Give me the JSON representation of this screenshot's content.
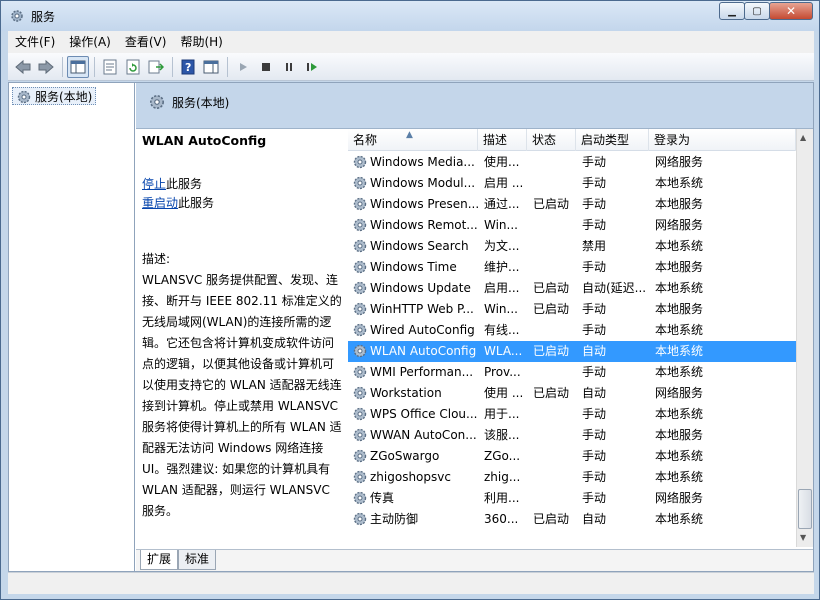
{
  "window": {
    "title": "服务"
  },
  "menu": [
    "文件(F)",
    "操作(A)",
    "查看(V)",
    "帮助(H)"
  ],
  "tree": {
    "root_label": "服务(本地)"
  },
  "pane": {
    "header_title": "服务(本地)"
  },
  "detail": {
    "service_name": "WLAN AutoConfig",
    "stop_link": "停止",
    "stop_suffix": "此服务",
    "restart_link": "重启动",
    "restart_suffix": "此服务",
    "desc_label": "描述:",
    "desc_lines": [
      "WLANSVC 服务提供配置、发现、连",
      "接、断开与 IEEE 802.11 标准定义的",
      "无线局域网(WLAN)的连接所需的逻",
      "辑。它还包含将计算机变成软件访问",
      "点的逻辑，以便其他设备或计算机可",
      "以使用支持它的 WLAN 适配器无线连",
      "接到计算机。停止或禁用 WLANSVC",
      "服务将使得计算机上的所有 WLAN 适",
      "配器无法访问 Windows 网络连接",
      "UI。强烈建议: 如果您的计算机具有",
      "WLAN 适配器，则运行 WLANSVC",
      "服务。"
    ]
  },
  "columns": {
    "name": "名称",
    "desc": "描述",
    "status": "状态",
    "startup": "启动类型",
    "logon": "登录为"
  },
  "rows": [
    {
      "name": "Windows Media...",
      "desc": "使用...",
      "status": "",
      "startup": "手动",
      "logon": "网络服务"
    },
    {
      "name": "Windows Modul...",
      "desc": "启用 ...",
      "status": "",
      "startup": "手动",
      "logon": "本地系统"
    },
    {
      "name": "Windows Presen...",
      "desc": "通过...",
      "status": "已启动",
      "startup": "手动",
      "logon": "本地服务"
    },
    {
      "name": "Windows Remot...",
      "desc": "Win...",
      "status": "",
      "startup": "手动",
      "logon": "网络服务"
    },
    {
      "name": "Windows Search",
      "desc": "为文...",
      "status": "",
      "startup": "禁用",
      "logon": "本地系统"
    },
    {
      "name": "Windows Time",
      "desc": "维护...",
      "status": "",
      "startup": "手动",
      "logon": "本地服务"
    },
    {
      "name": "Windows Update",
      "desc": "启用...",
      "status": "已启动",
      "startup": "自动(延迟...",
      "logon": "本地系统"
    },
    {
      "name": "WinHTTP Web P...",
      "desc": "Win...",
      "status": "已启动",
      "startup": "手动",
      "logon": "本地服务"
    },
    {
      "name": "Wired AutoConfig",
      "desc": "有线...",
      "status": "",
      "startup": "手动",
      "logon": "本地系统"
    },
    {
      "name": "WLAN AutoConfig",
      "desc": "WLA...",
      "status": "已启动",
      "startup": "自动",
      "logon": "本地系统"
    },
    {
      "name": "WMI Performan...",
      "desc": "Prov...",
      "status": "",
      "startup": "手动",
      "logon": "本地系统"
    },
    {
      "name": "Workstation",
      "desc": "使用 ...",
      "status": "已启动",
      "startup": "自动",
      "logon": "网络服务"
    },
    {
      "name": "WPS Office Clou...",
      "desc": "用于...",
      "status": "",
      "startup": "手动",
      "logon": "本地系统"
    },
    {
      "name": "WWAN AutoCon...",
      "desc": "该服...",
      "status": "",
      "startup": "手动",
      "logon": "本地服务"
    },
    {
      "name": "ZGoSwargo",
      "desc": "ZGo...",
      "status": "",
      "startup": "手动",
      "logon": "本地系统"
    },
    {
      "name": "zhigoshopsvc",
      "desc": "zhig...",
      "status": "",
      "startup": "手动",
      "logon": "本地系统"
    },
    {
      "name": "传真",
      "desc": "利用...",
      "status": "",
      "startup": "手动",
      "logon": "网络服务"
    },
    {
      "name": "主动防御",
      "desc": "360...",
      "status": "已启动",
      "startup": "自动",
      "logon": "本地系统"
    }
  ],
  "selected_row": "WLAN AutoConfig",
  "tabs": [
    "扩展",
    "标准"
  ],
  "colors": {
    "selection": "#3399ff",
    "link": "#0645ad",
    "header_band": "#c4d6ea"
  }
}
